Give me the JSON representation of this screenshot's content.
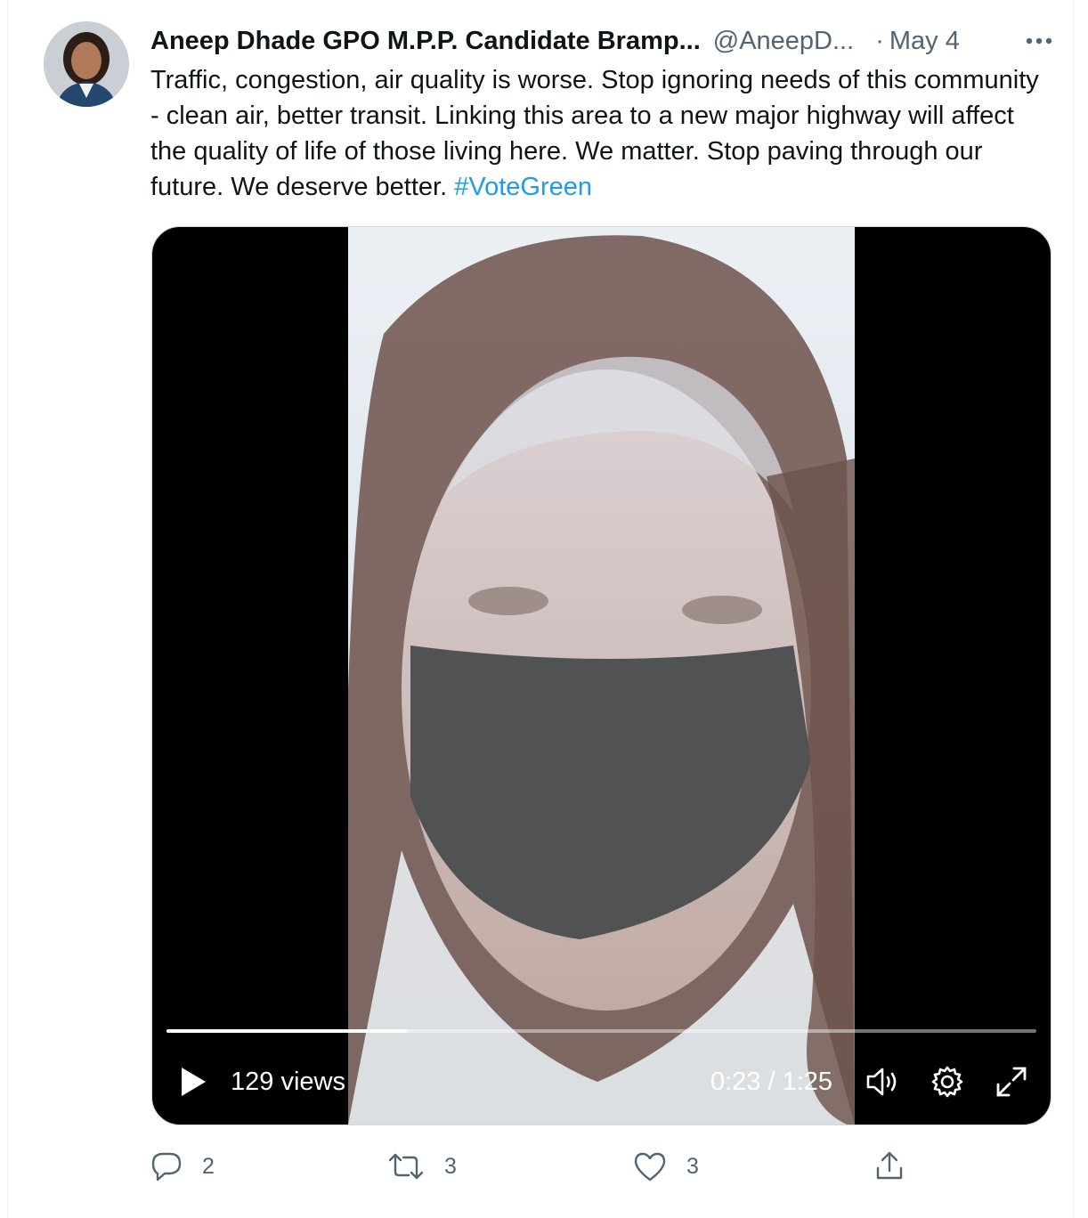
{
  "author": {
    "display_name": "Aneep Dhade GPO M.P.P. Candidate Bramp...",
    "handle": "@AneepD...",
    "separator": "·",
    "date": "May 4"
  },
  "tweet": {
    "text": "Traffic, congestion, air quality is worse. Stop ignoring needs of this community - clean air, better transit. Linking this area to a new major highway will affect the quality of life of those living here. We matter. Stop paving through our future. We deserve better. ",
    "hashtag": "#VoteGreen"
  },
  "video": {
    "views": "129 views",
    "time": "0:23 / 1:25",
    "progress_fraction": 0.276
  },
  "actions": {
    "reply_count": "2",
    "retweet_count": "3",
    "like_count": "3"
  },
  "icons": {
    "more": "more-icon",
    "play": "play-icon",
    "volume": "volume-icon",
    "settings": "gear-icon",
    "fullscreen": "fullscreen-icon",
    "reply": "reply-icon",
    "retweet": "retweet-icon",
    "like": "heart-icon",
    "share": "share-icon"
  },
  "colors": {
    "link": "#1d9bf0",
    "secondary_text": "#536471",
    "primary_text": "#0f1419"
  }
}
